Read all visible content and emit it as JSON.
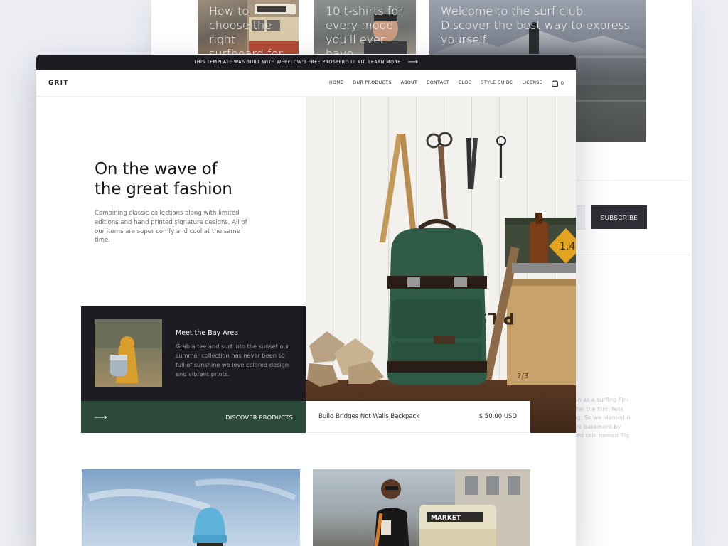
{
  "background_page": {
    "cards": [
      {
        "text": "How to choose the right surfboard for"
      },
      {
        "text": "10 t-shirts for every mood you'll ever have"
      },
      {
        "text": "Welcome to the surf club. Discover the best way to express yourself."
      }
    ],
    "subscribe_label": "SUBSCRIBE",
    "faded_text": "vegan as a surfing film ll. After the film, fans rthing. So we learned n a dark basement by striped skin named Big"
  },
  "banner": {
    "text": "THIS TEMPLATE WAS BUILT WITH WEBFLOW'S FREE PROSPERO UI KIT. LEARN MORE",
    "arrow": "⟶"
  },
  "nav": {
    "logo": "GRIT",
    "links": [
      "HOME",
      "OUR PRODUCTS",
      "ABOUT",
      "CONTACT",
      "BLOG",
      "STYLE GUIDE",
      "LICENSE"
    ],
    "cart_count": "0"
  },
  "hero": {
    "title_line1": "On the wave of",
    "title_line2": "the great fashion",
    "description": "Combining classic collections along with limited editions and hand printed signature designs. All of our items are super comfy and cool at the same time."
  },
  "feature_card": {
    "title": "Meet the Bay Area",
    "description": "Grab a tee and surf into the sunset our summer collection has never been so full of sunshine we love colored design and vibrant prints."
  },
  "cta": {
    "arrow": "⟶",
    "label": "DISCOVER PRODUCTS"
  },
  "product": {
    "name": "Build Bridges Not Walls Backpack",
    "price": "$ 50.00 USD"
  },
  "photo_labels": {
    "crate_text": "PILSEN",
    "crate_small": "2/3",
    "sign_number": "1.4",
    "tram_sign": "MARKET"
  },
  "colors": {
    "accent_green": "#2c4a3a",
    "dark": "#1c1c22",
    "page_bg": "#eceef4"
  }
}
